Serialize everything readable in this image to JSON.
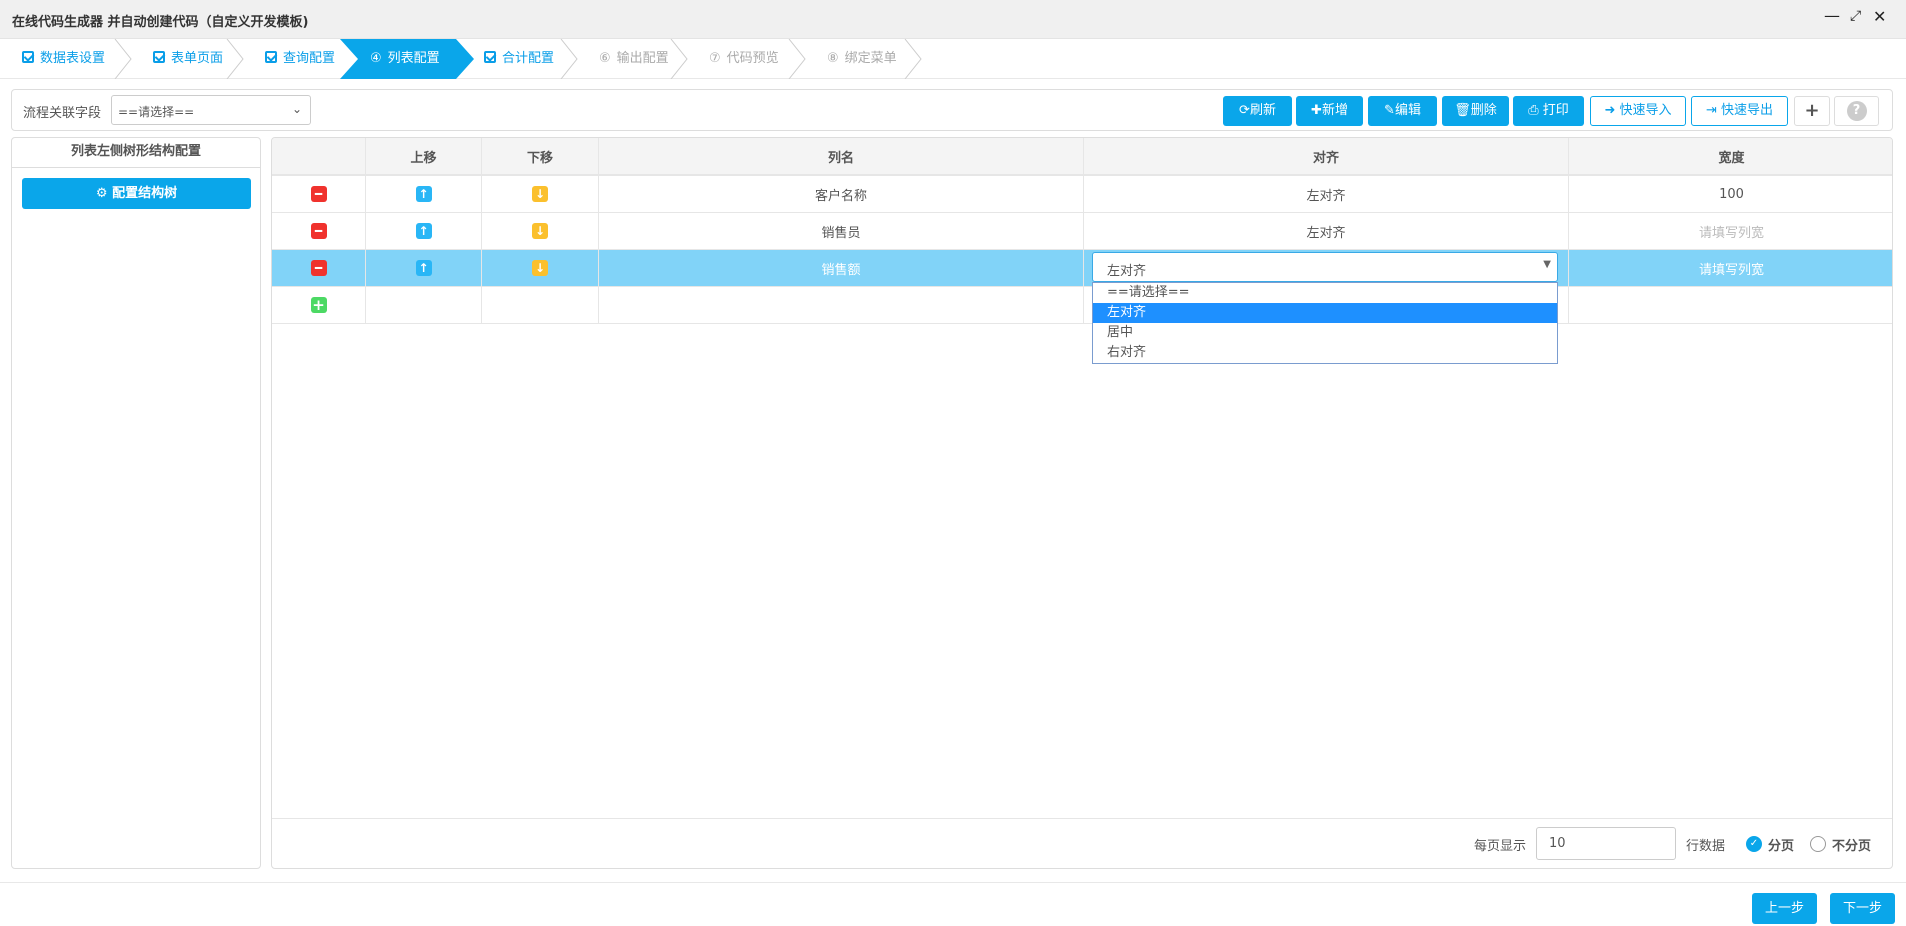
{
  "window": {
    "title": "在线代码生成器 并自动创建代码（自定义开发模板)",
    "minimize_icon": "minimize-icon",
    "maximize_icon": "maximize-icon",
    "close_icon": "close-icon"
  },
  "steps": [
    {
      "label": "数据表设置",
      "state": "done"
    },
    {
      "label": "表单页面",
      "state": "done"
    },
    {
      "label": "查询配置",
      "state": "done"
    },
    {
      "num": "④",
      "label": "列表配置",
      "state": "active"
    },
    {
      "label": "合计配置",
      "state": "done"
    },
    {
      "num": "⑥",
      "label": "输出配置",
      "state": "pending"
    },
    {
      "num": "⑦",
      "label": "代码预览",
      "state": "pending"
    },
    {
      "num": "⑧",
      "label": "绑定菜单",
      "state": "pending"
    }
  ],
  "toolbar": {
    "flow_field_label": "流程关联字段",
    "flow_field_value": "==请选择==",
    "refresh": "刷新",
    "add": "新增",
    "edit": "编辑",
    "delete": "删除",
    "print": "打印",
    "quick_import": "快速导入",
    "quick_export": "快速导出",
    "plus": "+",
    "help": "?"
  },
  "left_panel": {
    "title": "列表左侧树形结构配置",
    "config_tree_button": "配置结构树"
  },
  "table": {
    "headers": [
      "",
      "上移",
      "下移",
      "列名",
      "对齐",
      "宽度"
    ],
    "rows": [
      {
        "name": "客户名称",
        "align": "左对齐",
        "width": "100"
      },
      {
        "name": "销售员",
        "align": "左对齐",
        "width": "请填写列宽"
      },
      {
        "name": "销售额",
        "align": "左对齐",
        "width": "请填写列宽"
      }
    ]
  },
  "align_dropdown": {
    "value": "左对齐",
    "options": [
      "==请选择==",
      "左对齐",
      "居中",
      "右对齐"
    ],
    "highlighted": "左对齐"
  },
  "footer": {
    "per_page_label": "每页显示",
    "per_page_value": "10",
    "rows_label": "行数据",
    "paged": "分页",
    "not_paged": "不分页",
    "selected": "分页"
  },
  "nav": {
    "prev": "上一步",
    "next": "下一步"
  },
  "colors": {
    "accent": "#0aa6ea",
    "selected_row": "#81d3f8",
    "delete": "#f0322d",
    "up": "#29b6f6",
    "down": "#fbc02d",
    "add": "#4cd964"
  }
}
